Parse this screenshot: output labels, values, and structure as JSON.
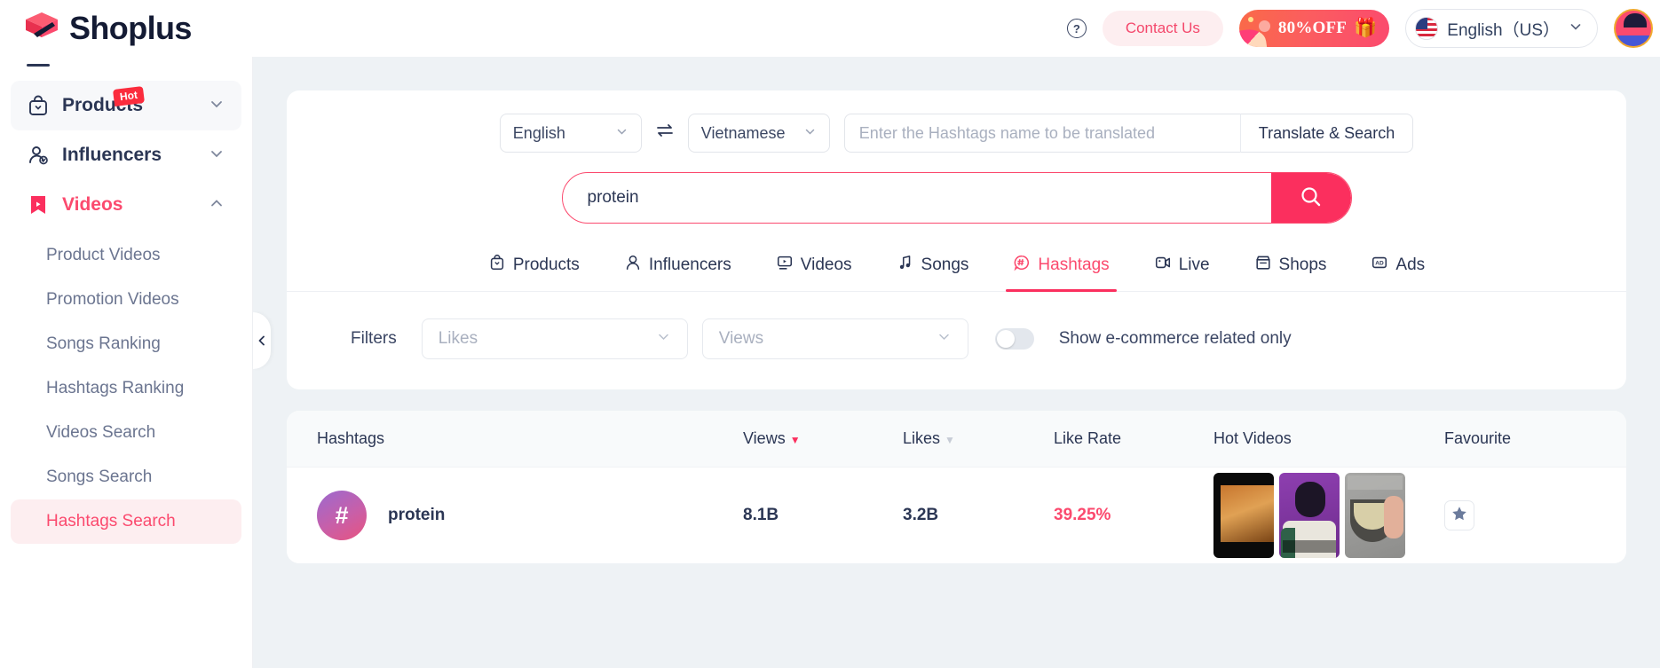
{
  "brand": {
    "name": "Shoplus"
  },
  "header": {
    "help_icon": "help-circle-icon",
    "contact_label": "Contact Us",
    "promo_label": "80%OFF",
    "promo_gift_icon": "gift-icon",
    "language": "English（US）",
    "avatar": "user-avatar"
  },
  "sidebar": {
    "items": [
      {
        "label": "Products",
        "icon": "bag-icon",
        "badge": "Hot",
        "arrow": "chevron-down-icon",
        "active": false,
        "highlight": true
      },
      {
        "label": "Influencers",
        "icon": "user-check-icon",
        "badge": "",
        "arrow": "chevron-down-icon",
        "active": false,
        "highlight": false
      },
      {
        "label": "Videos",
        "icon": "bookmark-play-icon",
        "badge": "",
        "arrow": "chevron-up-icon",
        "active": true,
        "highlight": false
      }
    ],
    "sub_items": [
      {
        "label": "Product Videos",
        "active": false
      },
      {
        "label": "Promotion Videos",
        "active": false
      },
      {
        "label": "Songs Ranking",
        "active": false
      },
      {
        "label": "Hashtags Ranking",
        "active": false
      },
      {
        "label": "Videos Search",
        "active": false
      },
      {
        "label": "Songs Search",
        "active": false
      },
      {
        "label": "Hashtags Search",
        "active": true
      }
    ],
    "collapse_icon": "chevron-left-icon"
  },
  "translate": {
    "source_lang": "English",
    "target_lang": "Vietnamese",
    "swap_icon": "swap-arrows-icon",
    "input_value": "",
    "input_placeholder": "Enter the Hashtags name to be translated",
    "button_label": "Translate & Search"
  },
  "search": {
    "value": "protein",
    "placeholder": "",
    "button_icon": "search-icon"
  },
  "tabs": [
    {
      "label": "Products",
      "icon": "bag-icon",
      "active": false
    },
    {
      "label": "Influencers",
      "icon": "person-icon",
      "active": false
    },
    {
      "label": "Videos",
      "icon": "video-screen-icon",
      "active": false
    },
    {
      "label": "Songs",
      "icon": "music-note-icon",
      "active": false
    },
    {
      "label": "Hashtags",
      "icon": "hashtag-bubble-icon",
      "active": true
    },
    {
      "label": "Live",
      "icon": "live-camera-icon",
      "active": false
    },
    {
      "label": "Shops",
      "icon": "shop-icon",
      "active": false
    },
    {
      "label": "Ads",
      "icon": "ad-icon",
      "active": false
    }
  ],
  "filters": {
    "label": "Filters",
    "likes_placeholder": "Likes",
    "views_placeholder": "Views",
    "toggle_on": false,
    "toggle_label": "Show e-commerce related only"
  },
  "table": {
    "columns": [
      {
        "key": "hashtags",
        "label": "Hashtags",
        "sort": "none"
      },
      {
        "key": "views",
        "label": "Views",
        "sort": "desc-active"
      },
      {
        "key": "likes",
        "label": "Likes",
        "sort": "desc-inactive"
      },
      {
        "key": "like_rate",
        "label": "Like Rate",
        "sort": "none"
      },
      {
        "key": "hot_videos",
        "label": "Hot Videos",
        "sort": "none"
      },
      {
        "key": "favourite",
        "label": "Favourite",
        "sort": "none"
      }
    ],
    "rows": [
      {
        "avatar_glyph": "#",
        "hashtag": "protein",
        "views": "8.1B",
        "likes": "3.2B",
        "like_rate": "39.25%",
        "hot_videos": [
          "video-thumb-1",
          "video-thumb-2",
          "video-thumb-3"
        ],
        "favourite_icon": "star-icon"
      }
    ]
  },
  "colors": {
    "accent": "#fb4a6e",
    "accent_strong": "#fb2f5e",
    "text": "#2b3654",
    "muted": "#6b7590",
    "page_bg": "#eef2f5"
  }
}
